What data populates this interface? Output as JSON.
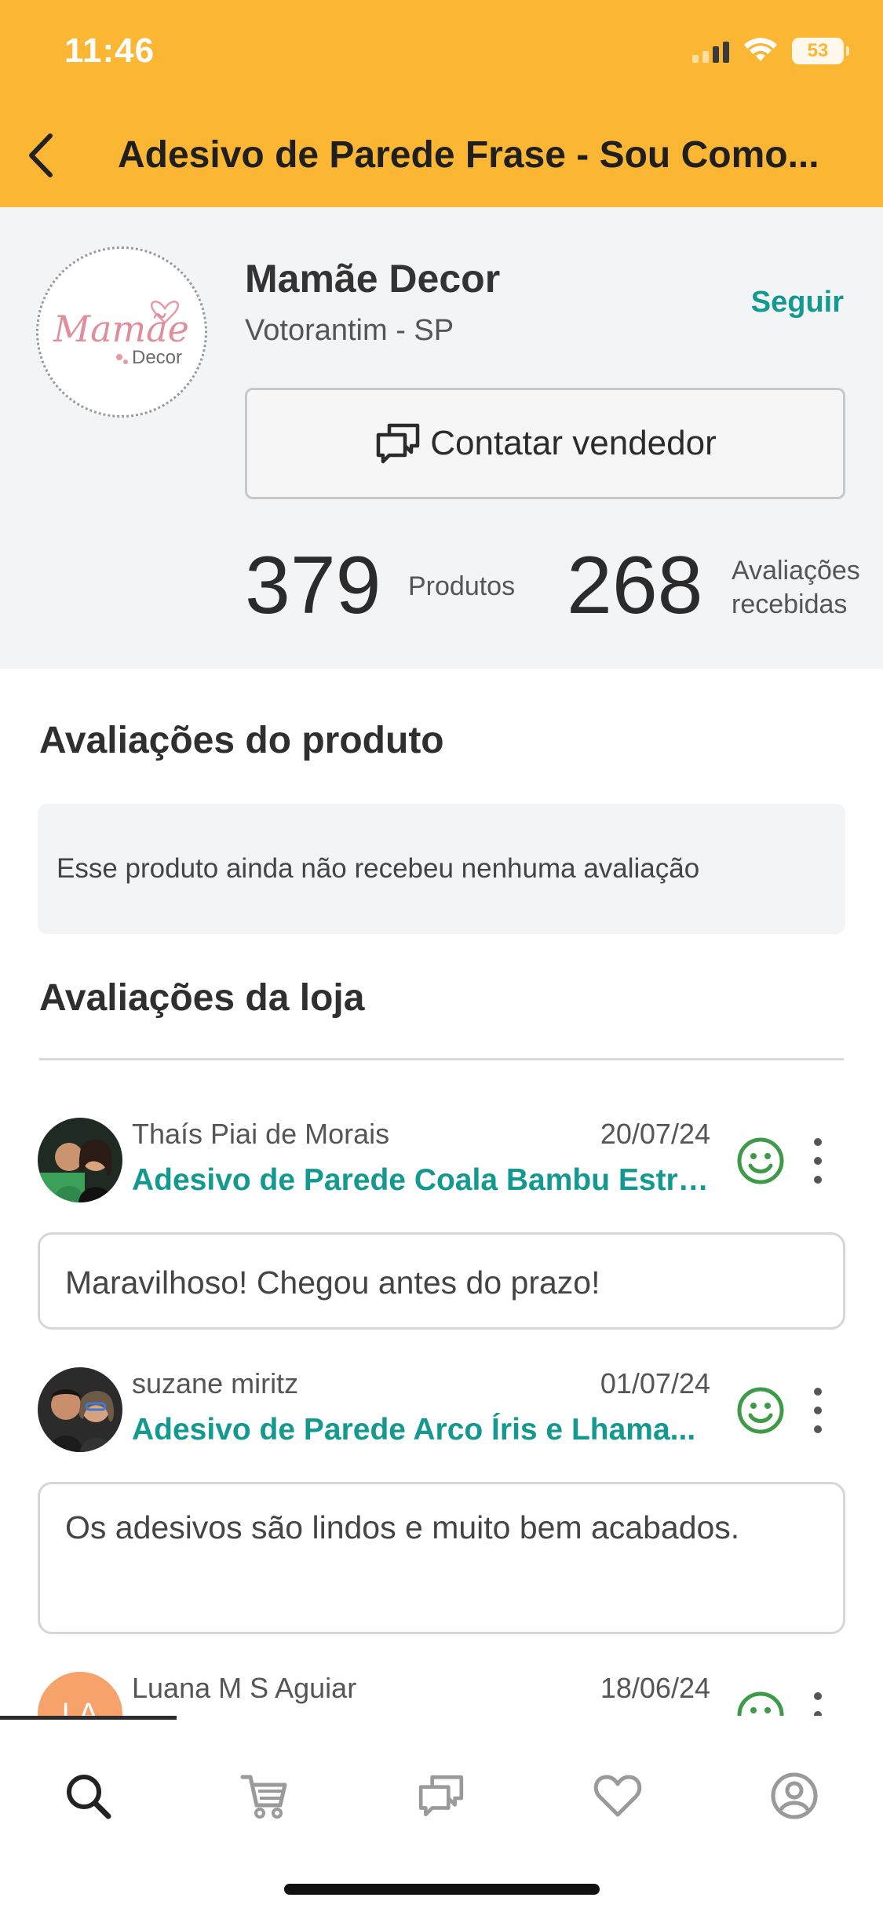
{
  "status_bar": {
    "time": "11:46",
    "battery": "53"
  },
  "nav": {
    "title": "Adesivo de Parede Frase - Sou Como..."
  },
  "store": {
    "logo_text": "Mamãe",
    "logo_subtext": "Decor",
    "name": "Mamãe Decor",
    "location": "Votorantim - SP",
    "follow_label": "Seguir",
    "contact_label": "Contatar vendedor",
    "products_count": "379",
    "products_label": "Produtos",
    "ratings_count": "268",
    "ratings_label_1": "Avaliações",
    "ratings_label_2": "recebidas"
  },
  "product_reviews": {
    "title": "Avaliações do produto",
    "empty_text": "Esse produto ainda não recebeu nenhuma avaliação"
  },
  "store_reviews": {
    "title": "Avaliações da loja",
    "items": [
      {
        "name": "Thaís Piai de Morais",
        "date": "20/07/24",
        "product": "Adesivo de Parede Coala Bambu Estre...",
        "comment": "Maravilhoso! Chegou antes do prazo!"
      },
      {
        "name": "suzane miritz",
        "date": "01/07/24",
        "product": "Adesivo de Parede Arco Íris e Lhama...",
        "comment": "Os adesivos são lindos e muito bem acabados."
      },
      {
        "name": "Luana M S Aguiar",
        "date": "18/06/24",
        "initials": "LA"
      }
    ]
  },
  "colors": {
    "accent": "#fbb634",
    "link": "#139990",
    "positive": "#3d9a47"
  },
  "tabs": [
    {
      "icon": "search-icon"
    },
    {
      "icon": "cart-icon"
    },
    {
      "icon": "chat-icon"
    },
    {
      "icon": "heart-icon"
    },
    {
      "icon": "profile-icon"
    }
  ]
}
